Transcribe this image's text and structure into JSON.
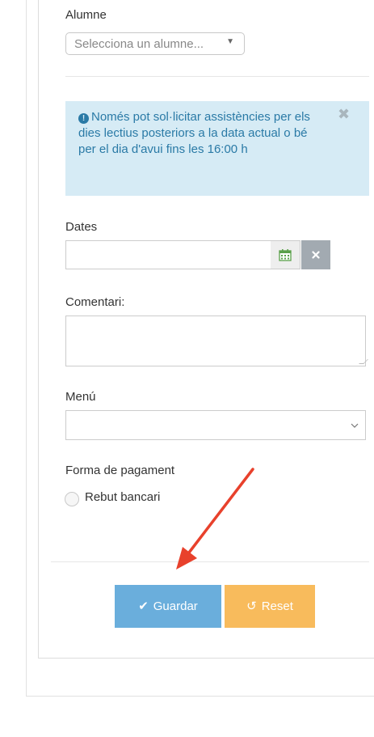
{
  "form": {
    "student_label": "Alumne",
    "student_select": "Selecciona un alumne...",
    "notice": "Només pot sol·licitar assistències per els dies lectius posteriors a la data actual o bé per el dia d'avui fins les 16:00 h",
    "dates_label": "Dates",
    "comment_label": "Comentari:",
    "menu_label": "Menú",
    "payment_label": "Forma de pagament",
    "payment_option": "Rebut bancari"
  },
  "buttons": {
    "save": "Guardar",
    "reset": "Reset"
  },
  "icons": {
    "info": "info-circle-icon",
    "close": "close-icon",
    "calendar": "calendar-icon",
    "clear": "clear-x-icon",
    "check": "check-icon",
    "undo": "undo-icon",
    "chevron": "chevron-down-icon"
  },
  "colors": {
    "alert_bg": "#d6ebf5",
    "alert_text": "#2a7aa6",
    "save_button": "#6aaedc",
    "reset_button": "#f8bb5c",
    "annotation_arrow": "#e8412c"
  }
}
